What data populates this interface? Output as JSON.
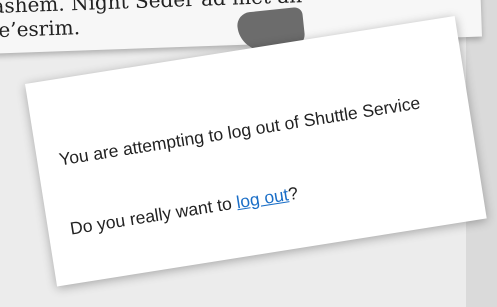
{
  "background_page": {
    "line_1": "ashem. Night Seder ad  met an",
    "line_2": "e’esrim."
  },
  "dialog": {
    "message": "You are attempting to log out of Shuttle Service",
    "question_prefix": "Do you really want to ",
    "logout_link_label": "log out",
    "question_suffix": "?"
  },
  "colors": {
    "link": "#1a6ec7",
    "card": "#ffffff",
    "background": "#ececec"
  }
}
